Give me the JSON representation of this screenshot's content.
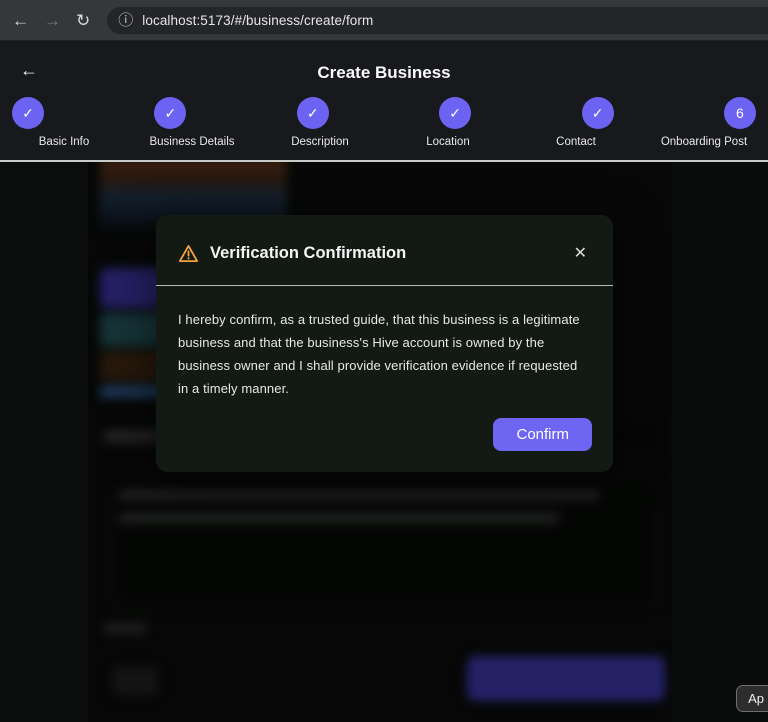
{
  "browser": {
    "url": "localhost:5173/#/business/create/form",
    "icons": {
      "back": "←",
      "forward": "→",
      "reload": "↻",
      "site_info": "ⓘ"
    }
  },
  "header": {
    "title": "Create Business",
    "back_icon": "←"
  },
  "stepper": {
    "accent_color": "#6d63f2",
    "steps": [
      {
        "label": "Basic Info",
        "mark": "✓",
        "state": "complete"
      },
      {
        "label": "Business Details",
        "mark": "✓",
        "state": "complete"
      },
      {
        "label": "Description",
        "mark": "✓",
        "state": "complete"
      },
      {
        "label": "Location",
        "mark": "✓",
        "state": "complete"
      },
      {
        "label": "Contact",
        "mark": "✓",
        "state": "complete"
      },
      {
        "label": "Onboarding Post",
        "mark": "6",
        "state": "current"
      }
    ]
  },
  "modal": {
    "title": "Verification Confirmation",
    "warning_icon": "warning-triangle",
    "close_icon": "✕",
    "body": "I hereby confirm, as a trusted guide, that this business is a legitimate business and that the business's Hive account is owned by the business owner and I shall provide verification evidence if requested in a timely manner.",
    "confirm_label": "Confirm",
    "accent_color": "#6e66f3",
    "warning_color": "#f2a33c"
  },
  "corner_chip": {
    "label": "Ap"
  }
}
